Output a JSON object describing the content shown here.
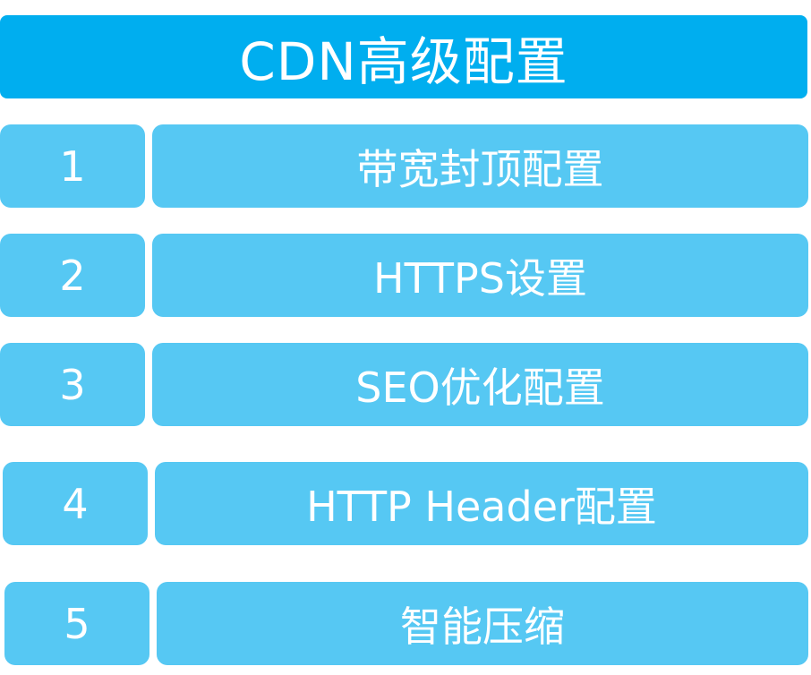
{
  "title": "CDN高级配置",
  "items": [
    {
      "number": "1",
      "label": "带宽封顶配置"
    },
    {
      "number": "2",
      "label": "HTTPS设置"
    },
    {
      "number": "3",
      "label": "SEO优化配置"
    },
    {
      "number": "4",
      "label": "HTTP Header配置"
    },
    {
      "number": "5",
      "label": "智能压缩"
    }
  ],
  "colors": {
    "title_background": "#00aeef",
    "item_background": "#56c8f3",
    "text": "#ffffff"
  }
}
